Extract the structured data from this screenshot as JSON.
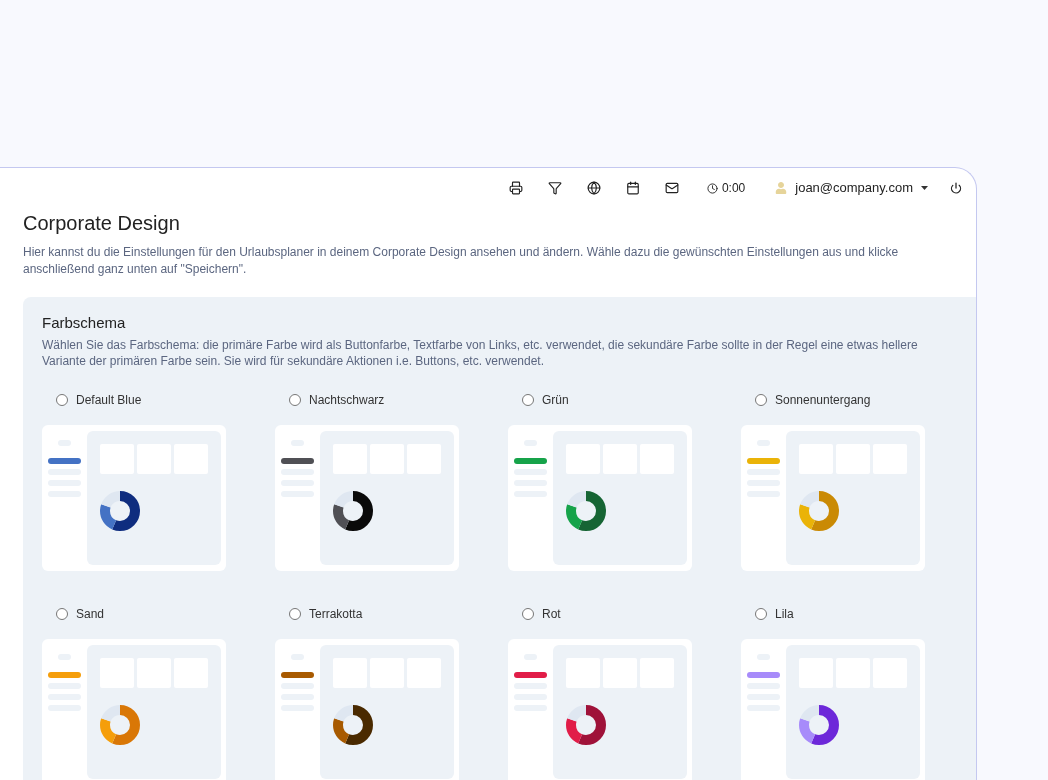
{
  "toolbar": {
    "timer": "0:00",
    "user": "joan@company.com"
  },
  "page": {
    "title": "Corporate Design",
    "description": "Hier kannst du die Einstellungen für den Urlaubsplaner in deinem Corporate Design ansehen und ändern. Wähle dazu die gewünschten Einstellungen aus und klicke anschließend ganz unten auf \"Speichern\"."
  },
  "color_scheme": {
    "title": "Farbschema",
    "description": "Wählen Sie das Farbschema: die primäre Farbe wird als Buttonfarbe, Textfarbe von Links, etc. verwendet, die sekundäre Farbe sollte in der Regel eine etwas hellere Variante der primären Farbe sein. Sie wird für sekundäre Aktionen i.e. Buttons, etc. verwendet.",
    "schemes": [
      {
        "label": "Default Blue",
        "selected": false,
        "swatches": [
          {
            "color": "#0f2d7f"
          },
          {
            "color": "#4472c4"
          }
        ]
      },
      {
        "label": "Nachtschwarz",
        "selected": false,
        "swatches": [
          {
            "color": "#0a0a0a"
          },
          {
            "color": "#505055"
          }
        ]
      },
      {
        "label": "Grün",
        "selected": false,
        "swatches": [
          {
            "color": "#166534"
          },
          {
            "color": "#16a34a"
          }
        ]
      },
      {
        "label": "Sonnenuntergang",
        "selected": false,
        "swatches": [
          {
            "color": "#ca8a04"
          },
          {
            "color": "#eab308"
          }
        ]
      },
      {
        "label": "Sand",
        "selected": false,
        "swatches": [
          {
            "color": "#d97706"
          },
          {
            "color": "#f59e0b"
          }
        ]
      },
      {
        "label": "Terrakotta",
        "selected": false,
        "swatches": [
          {
            "color": "#4a2a00"
          },
          {
            "color": "#a85a00"
          }
        ]
      },
      {
        "label": "Rot",
        "selected": false,
        "swatches": [
          {
            "color": "#9f1239"
          },
          {
            "color": "#e11d48"
          }
        ]
      },
      {
        "label": "Lila",
        "selected": false,
        "swatches": [
          {
            "color": "#6d28d9"
          },
          {
            "color": "#a78bfa"
          }
        ]
      }
    ]
  }
}
